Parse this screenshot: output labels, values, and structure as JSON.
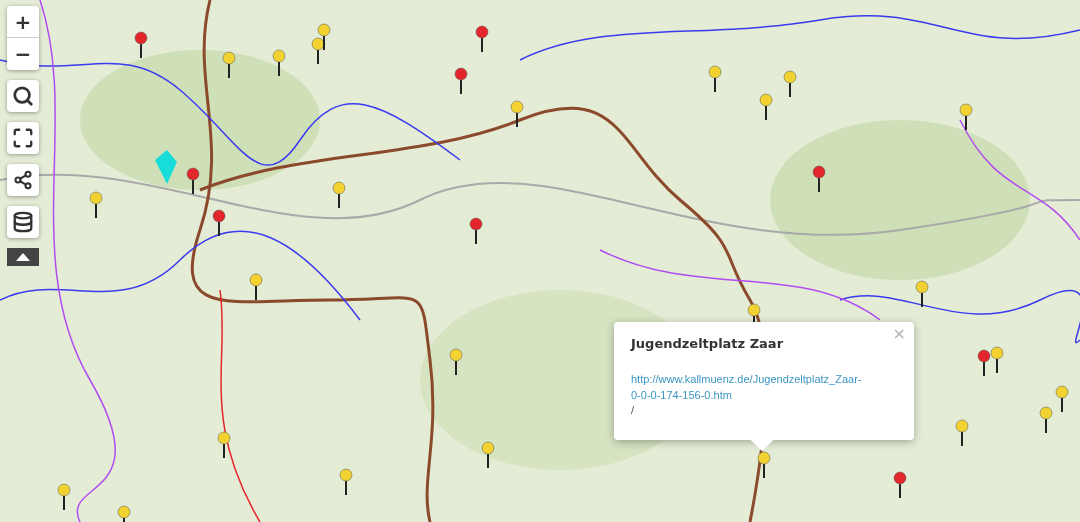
{
  "map_controls": {
    "zoom_in": "+",
    "zoom_out": "−"
  },
  "popup": {
    "title": "Jugendzeltplatz Zaar",
    "link": "http://www.kallmuenz.de/Jugendzeltplatz_Zaar-0-0-0-174-156-0.htm",
    "note": "/",
    "close": "×"
  }
}
